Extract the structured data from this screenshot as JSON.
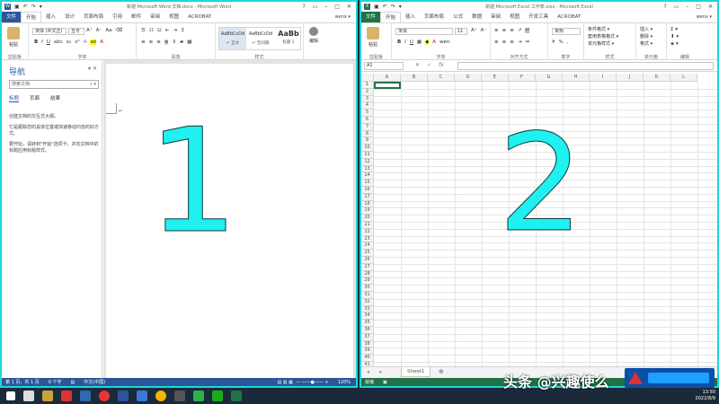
{
  "word": {
    "title": "新建 Microsoft Word 文档.docx - Microsoft Word",
    "tabs": [
      "文件",
      "开始",
      "插入",
      "设计",
      "页面布局",
      "引用",
      "邮件",
      "审阅",
      "视图",
      "ACROBAT"
    ],
    "user": "wenx ▾",
    "ribbon": {
      "paste_label": "粘贴",
      "clipboard_label": "剪贴板",
      "font_name": "宋体 (中文正)",
      "font_size": "五号",
      "font_group_label": "字体",
      "paragraph_group_label": "段落",
      "styles_group_label": "样式",
      "styles": [
        {
          "preview": "AaBbCcDd",
          "name": "↵ 正文"
        },
        {
          "preview": "AaBbCcDd",
          "name": "↵ 无间隔"
        },
        {
          "preview": "AaBb",
          "name": "标题 1"
        }
      ],
      "edit_label": "编辑"
    },
    "nav": {
      "title": "导航",
      "search_placeholder": "搜索文档",
      "tabs": [
        "标题",
        "页面",
        "结果"
      ],
      "text1": "创建文档的交互式大纲。",
      "text2": "它是跟踪您的具体位置或快速移动内容的好方式。",
      "text3": "要开始，请转到\"开始\"选项卡，并向文档中的标题应用标题样式。"
    },
    "status": {
      "page": "第 1 页，共 1 页",
      "words": "0 个字",
      "lang": "中文(中国)",
      "zoom": "120%"
    },
    "overlay_number": "1"
  },
  "excel": {
    "title": "新建 Microsoft Excel 工作表.xlsx - Microsoft Excel",
    "tabs": [
      "文件",
      "开始",
      "插入",
      "页面布局",
      "公式",
      "数据",
      "审阅",
      "视图",
      "开发工具",
      "ACROBAT"
    ],
    "user": "wenx ▾",
    "ribbon": {
      "paste_label": "粘贴",
      "clipboard_label": "剪贴板",
      "font_name": "宋体",
      "font_size": "11",
      "font_group_label": "字体",
      "align_group_label": "对齐方式",
      "number_format": "常规",
      "number_group_label": "数字",
      "cond_format": "条件格式 ▾",
      "table_format": "套用表格格式 ▾",
      "cell_styles": "单元格样式 ▾",
      "styles_group_label": "样式",
      "insert": "插入 ▾",
      "delete": "删除 ▾",
      "format": "格式 ▾",
      "cells_group_label": "单元格",
      "edit_group_label": "编辑"
    },
    "name_box": "A1",
    "columns": [
      "A",
      "B",
      "C",
      "D",
      "E",
      "F",
      "G",
      "H",
      "I",
      "J",
      "K",
      "L"
    ],
    "rows": [
      "1",
      "2",
      "3",
      "4",
      "5",
      "6",
      "7",
      "8",
      "9",
      "10",
      "11",
      "12",
      "13",
      "14",
      "15",
      "16",
      "17",
      "18",
      "19",
      "20",
      "21",
      "22",
      "23",
      "24",
      "25",
      "26",
      "27",
      "28",
      "29",
      "30",
      "31",
      "32",
      "33",
      "34",
      "35",
      "36",
      "37",
      "38",
      "39",
      "40",
      "41"
    ],
    "sheet_tab": "Sheet1",
    "status": "就绪",
    "overlay_number": "2"
  },
  "taskbar": {
    "time": "13:50",
    "date": "2022/8/9"
  },
  "watermark": "头条 @兴趣使么"
}
